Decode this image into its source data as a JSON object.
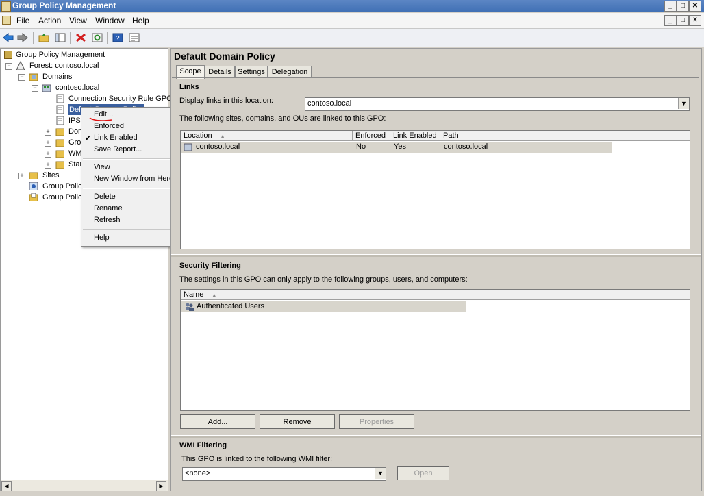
{
  "window": {
    "title": "Group Policy Management",
    "min_label": "_",
    "max_label": "□",
    "close_label": "✕"
  },
  "menu": {
    "items": [
      "File",
      "Action",
      "View",
      "Window",
      "Help"
    ]
  },
  "toolbar": {
    "buttons": [
      "back-icon",
      "forward-icon",
      "up-folder-icon",
      "show-hide-tree-icon",
      "delete-icon",
      "refresh-icon",
      "help-icon",
      "properties-icon"
    ]
  },
  "tree": {
    "root": "Group Policy Management",
    "forest": "Forest: contoso.local",
    "domains": "Domains",
    "domain": "contoso.local",
    "gpo_conn": "Connection Security Rule GPO",
    "gpo_default": "Default Domain Policy",
    "ipsec": "IPSe",
    "dom": "Dom",
    "grou": "Grou",
    "wmi": "WMI",
    "star": "Star",
    "sites": "Sites",
    "gp_model": "Group Policy",
    "gp_results": "Group Policy"
  },
  "context_menu": {
    "edit": "Edit...",
    "enforced": "Enforced",
    "link_enabled": "Link Enabled",
    "save_report": "Save Report...",
    "view": "View",
    "new_window": "New Window from Here",
    "delete": "Delete",
    "rename": "Rename",
    "refresh": "Refresh",
    "help": "Help",
    "check": "✔",
    "submenu_arrow": "▶"
  },
  "pane": {
    "title": "Default Domain Policy",
    "tabs": [
      "Scope",
      "Details",
      "Settings",
      "Delegation"
    ],
    "links": {
      "heading": "Links",
      "display_label": "Display links in this location:",
      "location_value": "contoso.local",
      "info": "The following sites, domains, and OUs are linked to this GPO:",
      "columns": [
        "Location",
        "Enforced",
        "Link Enabled",
        "Path"
      ],
      "rows": [
        [
          "contoso.local",
          "No",
          "Yes",
          "contoso.local"
        ]
      ]
    },
    "security": {
      "heading": "Security Filtering",
      "info": "The settings in this GPO can only apply to the following groups, users, and computers:",
      "columns": [
        "Name"
      ],
      "rows": [
        [
          "Authenticated Users"
        ]
      ],
      "add": "Add...",
      "remove": "Remove",
      "properties": "Properties"
    },
    "wmi": {
      "heading": "WMI Filtering",
      "info": "This GPO is linked to the following WMI filter:",
      "value": "<none>",
      "open": "Open"
    }
  },
  "colors": {
    "title_bar": "#3f6fb4",
    "selection": "#3a5f9e"
  }
}
